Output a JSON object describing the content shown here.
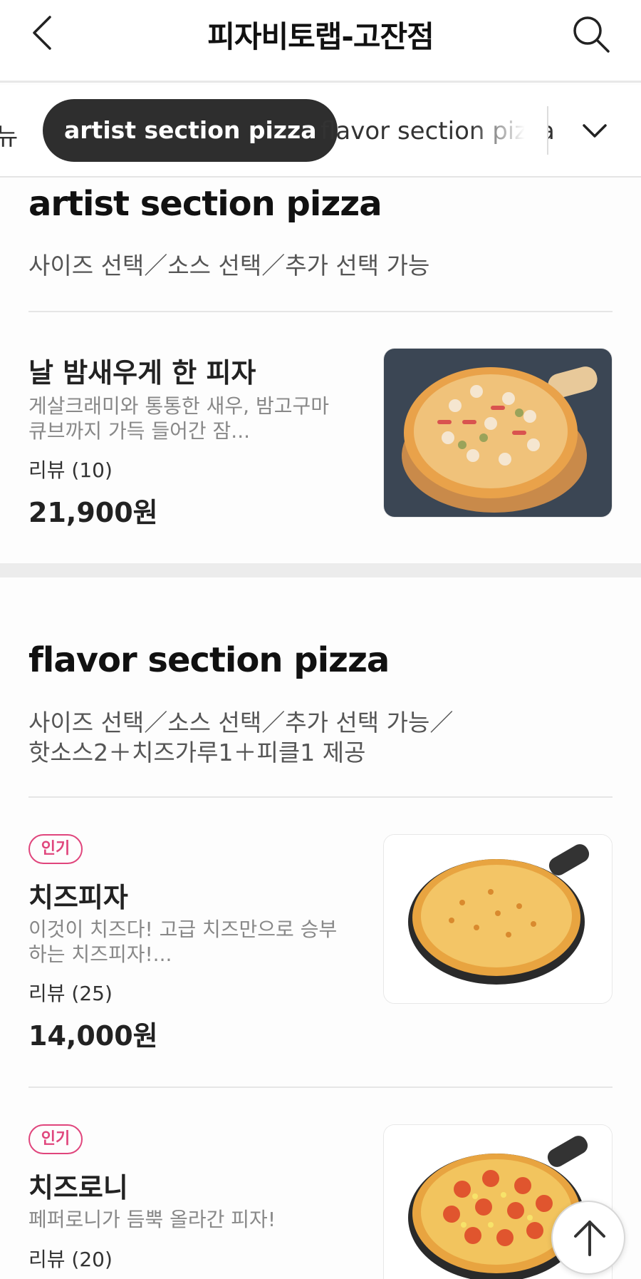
{
  "header": {
    "title": "피자비토랩-고잔점"
  },
  "tabs": {
    "partial_prev": "뉴",
    "active": "artist section pizza",
    "next": "flavor section pizza"
  },
  "sections": [
    {
      "title": "artist section pizza",
      "desc": "사이즈 선택／소스 선택／추가 선택 가능",
      "items": [
        {
          "name": "날 밤새우게 한 피자",
          "desc": "게살크래미와 통통한 새우, 밤고구마큐브까지 가득 들어간 잠...",
          "review": "리뷰 (10)",
          "price": "21,900원"
        }
      ]
    },
    {
      "title": "flavor section pizza",
      "desc": "사이즈 선택／소스 선택／추가 선택 가능／핫소스2＋치즈가루1＋피클1 제공",
      "items": [
        {
          "badge": "인기",
          "name": "치즈피자",
          "desc": "이것이 치즈다! 고급 치즈만으로 승부하는 치즈피자!...",
          "review": "리뷰 (25)",
          "price": "14,000원"
        },
        {
          "badge": "인기",
          "name": "치즈로니",
          "desc": "페퍼로니가 듬뿍 올라간 피자!",
          "review": "리뷰 (20)"
        }
      ]
    }
  ],
  "icons": {
    "back": "back-arrow-icon",
    "search": "search-icon",
    "expand": "chevron-down-icon",
    "scroll_top": "arrow-up-icon"
  },
  "colors": {
    "badge": "#e0457c",
    "active_tab": "#2e2e2e"
  }
}
